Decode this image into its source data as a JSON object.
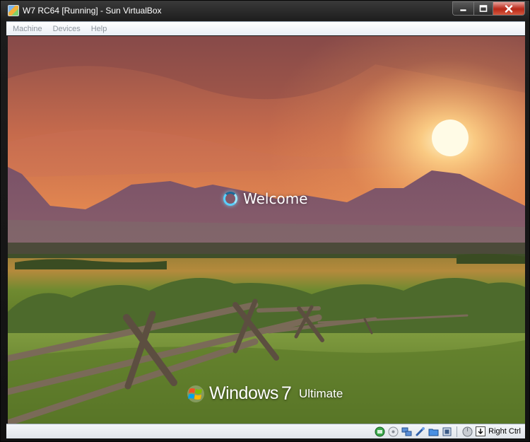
{
  "window": {
    "title": "W7 RC64 [Running] - Sun VirtualBox",
    "icon": "virtualbox-app-icon"
  },
  "caption_buttons": [
    "minimize-icon",
    "maximize-icon",
    "close-icon"
  ],
  "menubar": {
    "items": [
      "Machine",
      "Devices",
      "Help"
    ]
  },
  "guest": {
    "welcome_text": "Welcome",
    "brand": {
      "name": "Windows",
      "version": "7",
      "edition": "Ultimate"
    }
  },
  "statusbar": {
    "icons": [
      "hard-disk-icon",
      "cd-dvd-icon",
      "network-icon",
      "usb-icon",
      "shared-folders-icon",
      "virtualization-icon",
      "mouse-integration-icon"
    ],
    "host_key_label": "Right Ctrl"
  },
  "colors": {
    "sky_top": "#8a4a48",
    "sun": "#fff6c8",
    "mountains": "#6f4e66",
    "grass": "#5f7a2a",
    "menubar": "#eef2f7",
    "menu_text_disabled": "#8c949c"
  }
}
